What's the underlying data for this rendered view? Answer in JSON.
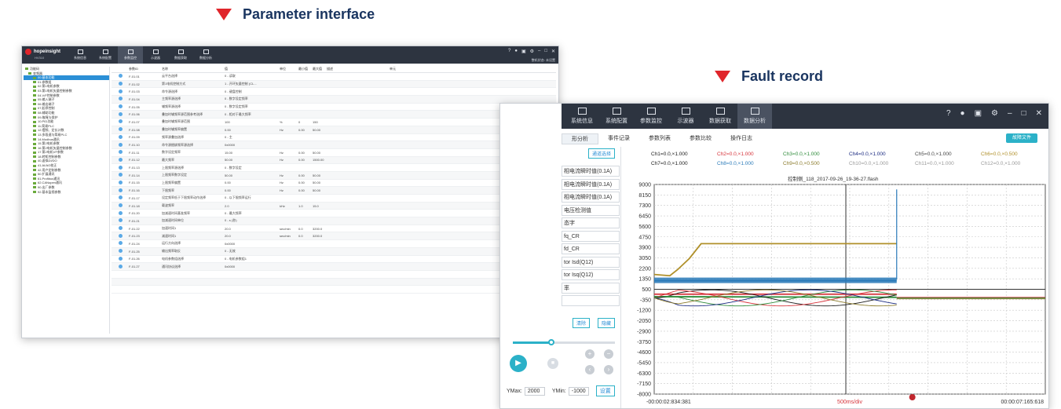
{
  "captions": {
    "left": "Parameter interface",
    "right": "Fault record"
  },
  "win1": {
    "brand": "hopeinsight",
    "version": "HV310",
    "tabs": [
      "系统信息",
      "系统配置",
      "参数监控",
      "示波器",
      "数据获取",
      "数据分析"
    ],
    "active_tab": 2,
    "status": "整机状态: 未设置",
    "tree": [
      "功能码",
      "变频器",
      "00.基本功能",
      "01.参数组",
      "02.第1电机参数",
      "03.第1电机矢量控制参数",
      "04.V/F控制参数",
      "05.输入端子",
      "06.输出端子",
      "07.起停控制",
      "08.辅助功能",
      "09.故障与保护",
      "10.PID功能",
      "11.简易PLC",
      "12.摆频、定长计数",
      "13.多段速与简易PLC",
      "14.Modbus通讯",
      "15.第2电机参数",
      "16.第2电机矢量控制参数",
      "17.第2电机VF参数",
      "18.转矩控制参数",
      "40.虚拟DI/DO",
      "41.AI/AO校正",
      "42.用户定制参数",
      "50.扩展通讯",
      "61.Profibus通讯",
      "62.CANopen通讯",
      "90.出厂参数",
      "92.基本监视参数"
    ],
    "selected_tree": 2,
    "columns": [
      "",
      "参数ID",
      "名称",
      "值",
      "单位",
      "最小值",
      "最大值",
      "描述",
      "单元"
    ],
    "rows": [
      [
        "F-01.01",
        "云平台选择",
        "0 - 读取",
        "",
        "",
        "",
        ""
      ],
      [
        "F-01.02",
        "第1电机控制方式",
        "1 - 开环矢量控制 (CL...",
        "",
        "",
        "",
        ""
      ],
      [
        "F-01.03",
        "命令源选择",
        "0 - 键盘控制",
        "",
        "",
        "",
        ""
      ],
      [
        "F-01.04",
        "主频率源选择",
        "0 - 数字设定频率",
        "",
        "",
        "",
        ""
      ],
      [
        "F-01.05",
        "辅频率源选择",
        "0 - 数字设定频率",
        "",
        "",
        "",
        ""
      ],
      [
        "F-01.06",
        "叠加时辅频率源范围参考选择",
        "0 - 相对于最大频率",
        "",
        "",
        "",
        ""
      ],
      [
        "F-01.07",
        "叠加时辅频率源范围",
        "100",
        "%",
        "0",
        "150",
        ""
      ],
      [
        "F-01.08",
        "叠加时辅频率偏置",
        "0.00",
        "Hz",
        "0.00",
        "50.00",
        ""
      ],
      [
        "F-01.09",
        "频率源叠加选择",
        "0 - 主",
        "",
        "",
        "",
        ""
      ],
      [
        "F-01.10",
        "命令源捆绑频率源选择",
        "0x0000",
        "",
        "",
        "",
        ""
      ],
      [
        "F-01.11",
        "数字设定频率",
        "15.00",
        "Hz",
        "0.00",
        "50.00",
        ""
      ],
      [
        "F-01.12",
        "最大频率",
        "50.00",
        "Hz",
        "0.00",
        "1500.00",
        ""
      ],
      [
        "F-01.13",
        "上限频率源选择",
        "0 - 数字设定",
        "",
        "",
        "",
        ""
      ],
      [
        "F-01.14",
        "上限频率数字设定",
        "50.00",
        "Hz",
        "0.00",
        "50.00",
        ""
      ],
      [
        "F-01.15",
        "上限频率偏置",
        "0.00",
        "Hz",
        "0.00",
        "50.00",
        ""
      ],
      [
        "F-01.16",
        "下限频率",
        "0.00",
        "Hz",
        "0.00",
        "50.00",
        ""
      ],
      [
        "F-01.17",
        "设定频率低于下限频率动作选择",
        "0 - 以下限频率运行",
        "",
        "",
        "",
        ""
      ],
      [
        "F-01.18",
        "载波频率",
        "2.0",
        "kHz",
        "1.0",
        "15.0",
        ""
      ],
      [
        "F-01.20",
        "加减速时间基准频率",
        "0 - 最大频率",
        "",
        "",
        "",
        ""
      ],
      [
        "F-01.21",
        "加减速时间单位",
        "0 - s (秒)",
        "",
        "",
        "",
        ""
      ],
      [
        "F-01.22",
        "加速时间1",
        "20.0",
        "sec/min",
        "0.0",
        "3200.0",
        ""
      ],
      [
        "F-01.23",
        "减速时间1",
        "20.0",
        "sec/min",
        "0.0",
        "3200.0",
        ""
      ],
      [
        "F-01.24",
        "运行方向选择",
        "0x0000",
        "",
        "",
        "",
        ""
      ],
      [
        "F-01.25",
        "输出频率取反",
        "0 - 无效",
        "",
        "",
        "",
        ""
      ],
      [
        "F-01.26",
        "电机参数组选择",
        "0 - 电机参数组1",
        "",
        "",
        "",
        ""
      ],
      [
        "F-01.27",
        "通讯协议选择",
        "0x0000",
        "",
        "",
        "",
        ""
      ]
    ]
  },
  "win2": {
    "tabs": [
      "系统信息",
      "系统配置",
      "参数监控",
      "示波器",
      "数据获取",
      "数据分析"
    ],
    "active_tab": 5,
    "subtabs": [
      "形分析",
      "事件记录",
      "参数列表",
      "参数比较",
      "操作日志"
    ],
    "active_subtab": 0,
    "export_label": "故障文件",
    "channel_select": "通道选择",
    "list": [
      "相电流瞬时值(0.1A)",
      "相电流瞬时值(0.1A)",
      "相电流瞬时值(0.1A)",
      "电压检测值",
      "态字",
      "fq_CR",
      "fd_CR",
      "tor Isd(Q12)",
      "tor Isq(Q12)",
      "率",
      ""
    ],
    "clear_label": "清除",
    "hide_label": "隐藏",
    "ymax_label": "YMax:",
    "ymax_value": "2000",
    "ymin_label": "YMin:",
    "ymin_value": "-1000",
    "set_label": "设置",
    "slider_position": 0.38,
    "channels": [
      {
        "label": "Ch1=0.0,×1.000",
        "color": "#1a1a1a"
      },
      {
        "label": "Ch2=0.0,×1.000",
        "color": "#d6333a"
      },
      {
        "label": "Ch3=0.0,×1.000",
        "color": "#2e8b3a"
      },
      {
        "label": "Ch4=0.0,×1.000",
        "color": "#1a2a80"
      },
      {
        "label": "Ch5=0.0,×1.000",
        "color": "#444444"
      },
      {
        "label": "Ch6=0.0,×0.500",
        "color": "#b0902a"
      },
      {
        "label": "Ch7=0.0,×1.000",
        "color": "#1a1a1a"
      },
      {
        "label": "Ch8=0.0,×1.000",
        "color": "#2a7ab8"
      },
      {
        "label": "Ch9=0.0,×0.500",
        "color": "#8a7a2a"
      },
      {
        "label": "Ch10=0.0,×1.000",
        "color": "#9a9a9a"
      },
      {
        "label": "Ch11=0.0,×1.000",
        "color": "#9a9a9a"
      },
      {
        "label": "Ch12=0.0,×1.000",
        "color": "#9a9a9a"
      }
    ],
    "plot_title": "控制侧_118_2017-09-26_19-36-27.flash",
    "y_ticks": [
      "9000",
      "8150",
      "7300",
      "6450",
      "5600",
      "4750",
      "3900",
      "3050",
      "2200",
      "1350",
      "500",
      "-350",
      "-1200",
      "-2050",
      "-2900",
      "-3750",
      "-4600",
      "-5450",
      "-6300",
      "-7150",
      "-8000"
    ],
    "x_start": "-00:00:02:834:381",
    "x_div": "500ms/div",
    "x_end": "00:00:07:165:618",
    "chart_data": {
      "type": "line",
      "y_range": [
        -8000,
        9000
      ],
      "series": [
        {
          "name": "Ch6",
          "color": "#b0902a",
          "points": [
            [
              0.0,
              1700
            ],
            [
              0.04,
              1600
            ],
            [
              0.06,
              2100
            ],
            [
              0.09,
              3000
            ],
            [
              0.12,
              4200
            ],
            [
              0.6,
              4200
            ],
            [
              0.62,
              4200
            ]
          ]
        },
        {
          "name": "Ch8",
          "color": "#2a7ab8",
          "points": [
            [
              0.0,
              1200
            ],
            [
              0.62,
              1200
            ]
          ]
        },
        {
          "name": "Ch3",
          "color": "#2e8b3a",
          "points": [
            [
              0.0,
              -100
            ],
            [
              0.62,
              -150
            ]
          ]
        },
        {
          "name": "Ch2",
          "color": "#d6333a",
          "points": [
            [
              0.0,
              100
            ],
            [
              0.62,
              100
            ]
          ]
        }
      ]
    }
  }
}
